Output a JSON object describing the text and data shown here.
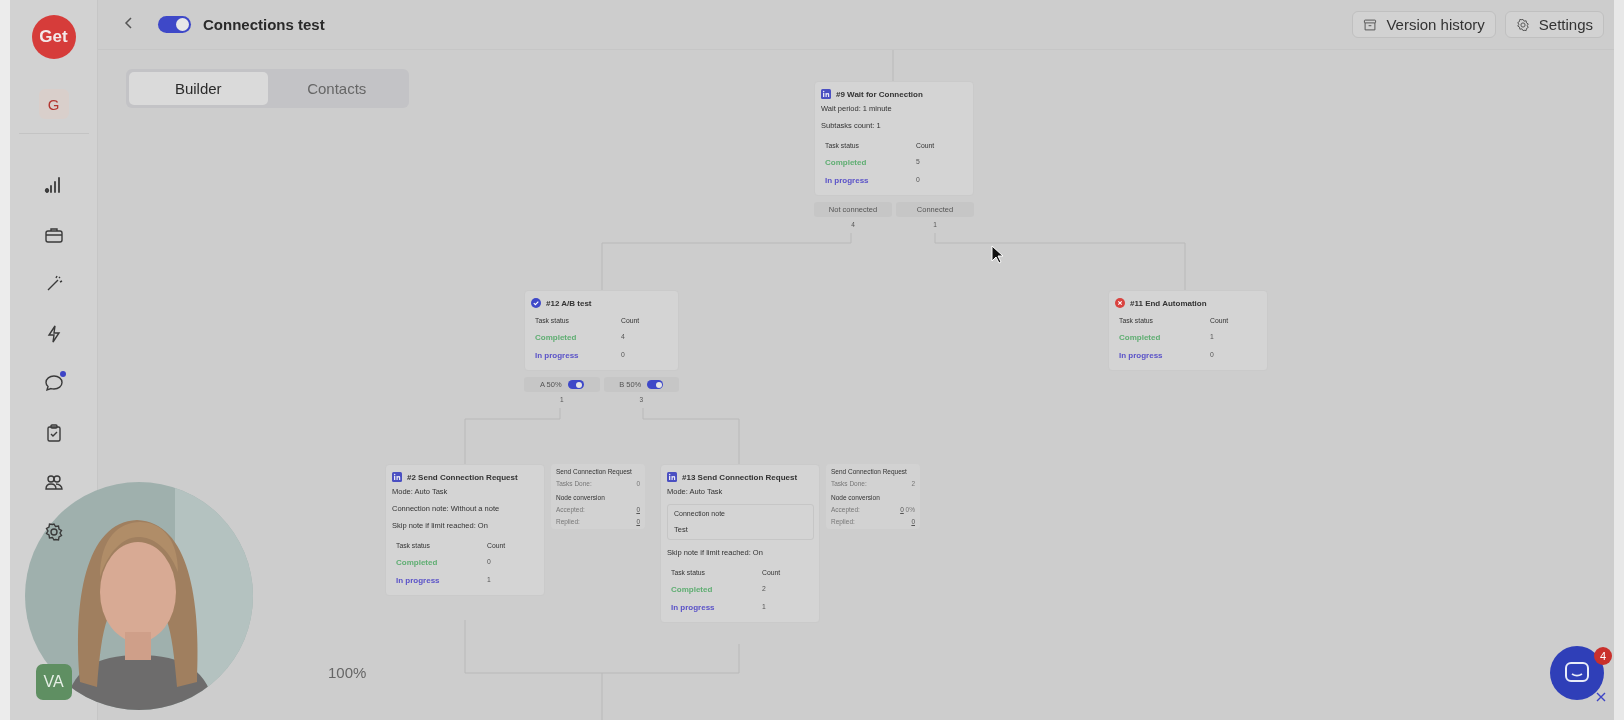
{
  "sidebar": {
    "logo": "Get",
    "workspace": "G",
    "items": [
      {
        "kind": "chart",
        "unread": false
      },
      {
        "kind": "briefcase",
        "unread": false
      },
      {
        "kind": "wand",
        "unread": false
      },
      {
        "kind": "bolt",
        "unread": false
      },
      {
        "kind": "chat",
        "unread": true
      },
      {
        "kind": "clipboard",
        "unread": false
      },
      {
        "kind": "people",
        "unread": false
      },
      {
        "kind": "gear",
        "unread": false
      }
    ],
    "avatar": "VA"
  },
  "header": {
    "enabled": true,
    "title": "Connections test",
    "buttons": [
      {
        "kind": "history",
        "label": "Version history"
      },
      {
        "kind": "settings",
        "label": "Settings"
      }
    ]
  },
  "tabs": [
    {
      "label": "Builder",
      "selected": true
    },
    {
      "label": "Contacts",
      "selected": false
    }
  ],
  "nodes": [
    {
      "kind": "wait",
      "title": "#9 Wait for Connection",
      "lines": [
        "Wait period: 1 minute",
        "Subtasks count: 1"
      ],
      "columns": [
        "Task status",
        "Count"
      ],
      "rows": [
        {
          "status": "Completed",
          "count": "5",
          "color": "#5fae72"
        },
        {
          "status": "In progress",
          "count": "0",
          "color": "#5a52c8"
        }
      ],
      "branches": [
        {
          "label": "Not connected",
          "count": "4"
        },
        {
          "label": "Connected",
          "count": "1"
        }
      ]
    },
    {
      "kind": "abtest",
      "title": "#12 A/B test",
      "columns": [
        "Task status",
        "Count"
      ],
      "rows": [
        {
          "status": "Completed",
          "count": "4",
          "color": "#5fae72"
        },
        {
          "status": "In progress",
          "count": "0",
          "color": "#5a52c8"
        }
      ],
      "branches": [
        {
          "label": "A 50%",
          "on": true,
          "count": "1"
        },
        {
          "label": "B 50%",
          "on": true,
          "count": "3"
        }
      ]
    },
    {
      "kind": "end",
      "title": "#11 End Automation",
      "columns": [
        "Task status",
        "Count"
      ],
      "rows": [
        {
          "status": "Completed",
          "count": "1",
          "color": "#5fae72"
        },
        {
          "status": "In progress",
          "count": "0",
          "color": "#5a52c8"
        }
      ]
    },
    {
      "kind": "send",
      "title": "#2 Send Connection Request",
      "lines": [
        "Mode: Auto Task",
        "Connection note: Without a note",
        "Skip note if limit reached: On"
      ],
      "columns": [
        "Task status",
        "Count"
      ],
      "rows": [
        {
          "status": "Completed",
          "count": "0",
          "color": "#5fae72"
        },
        {
          "status": "In progress",
          "count": "1",
          "color": "#5a52c8"
        }
      ],
      "stats": {
        "title": "Send Connection Request",
        "done_label": "Tasks Done:",
        "done": "0",
        "conversion": "Node conversion",
        "accepted_label": "Accepted:",
        "accepted": "0",
        "replied_label": "Replied:",
        "replied": "0"
      }
    },
    {
      "kind": "send",
      "title": "#13 Send Connection Request",
      "lines": [
        "Mode: Auto Task"
      ],
      "note_label": "Connection note",
      "note": "Test",
      "after_lines": [
        "Skip note if limit reached: On"
      ],
      "columns": [
        "Task status",
        "Count"
      ],
      "rows": [
        {
          "status": "Completed",
          "count": "2",
          "color": "#5fae72"
        },
        {
          "status": "In progress",
          "count": "1",
          "color": "#5a52c8"
        }
      ],
      "stats": {
        "title": "Send Connection Request",
        "done_label": "Tasks Done:",
        "done": "2",
        "conversion": "Node conversion",
        "accepted_label": "Accepted:",
        "accepted": "0",
        "accepted_pct": "0%",
        "replied_label": "Replied:",
        "replied": "0"
      }
    }
  ],
  "zoom": "100%",
  "chat_launcher": {
    "badge": "4"
  }
}
